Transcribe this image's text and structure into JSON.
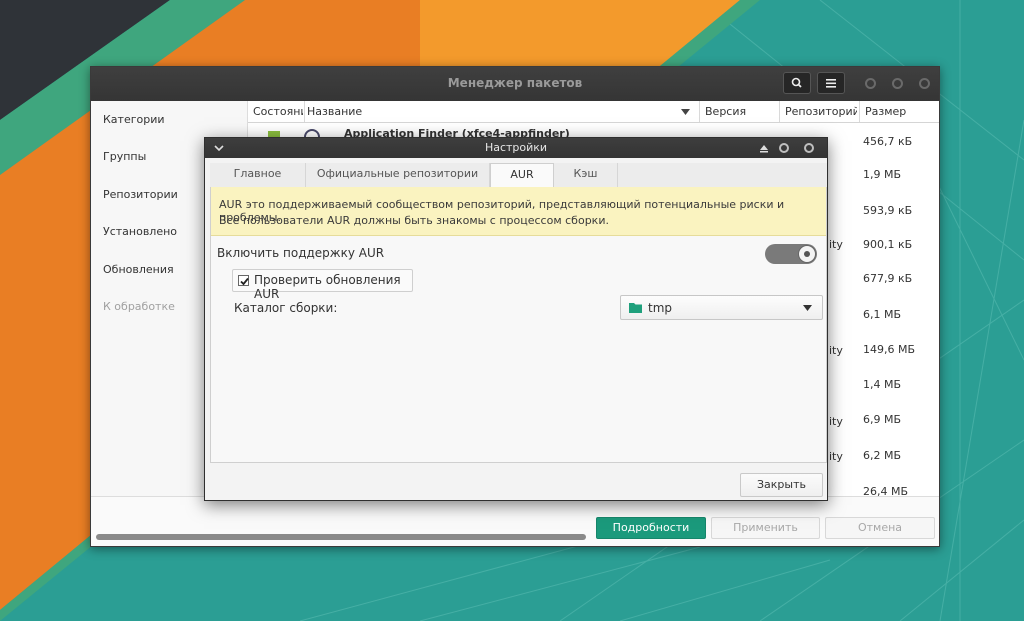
{
  "main_window": {
    "title": "Менеджер пакетов",
    "sidebar": [
      "Категории",
      "Группы",
      "Репозитории",
      "Установлено",
      "Обновления",
      "К обработке"
    ],
    "columns": [
      "Состояние",
      "Название",
      "Версия",
      "Репозиторий",
      "Размер"
    ],
    "first_row_name": "Application Finder (xfce4-appfinder)",
    "repo_fragments": [
      "ity",
      "ity",
      "ity",
      "ity"
    ],
    "sizes": [
      "456,7 кБ",
      "1,9 МБ",
      "593,9 кБ",
      "900,1 кБ",
      "677,9 кБ",
      "6,1 МБ",
      "149,6 МБ",
      "1,4 МБ",
      "6,9 МБ",
      "6,2 МБ",
      "26,4 МБ"
    ],
    "buttons": {
      "details": "Подробности",
      "apply": "Применить",
      "cancel": "Отмена"
    }
  },
  "settings_dialog": {
    "title": "Настройки",
    "tabs": [
      "Главное",
      "Официальные репозитории",
      "AUR",
      "Кэш"
    ],
    "active_tab": "AUR",
    "notice_line1": "AUR это поддерживаемый сообществом репозиторий, представляющий потенциальные риски и проблемы.",
    "notice_line2": "Все пользователи AUR должны быть знакомы с процессом сборки.",
    "enable_aur_label": "Включить поддержку AUR",
    "enable_aur": true,
    "check_updates_label": "Проверить обновления AUR",
    "check_updates": true,
    "build_dir_label": "Каталог сборки:",
    "build_dir_value": "tmp",
    "close_button": "Закрыть"
  },
  "colors": {
    "accent": "#1b9a7c",
    "notice": "#faf3c0",
    "titlebar": "#3a3a3a"
  }
}
